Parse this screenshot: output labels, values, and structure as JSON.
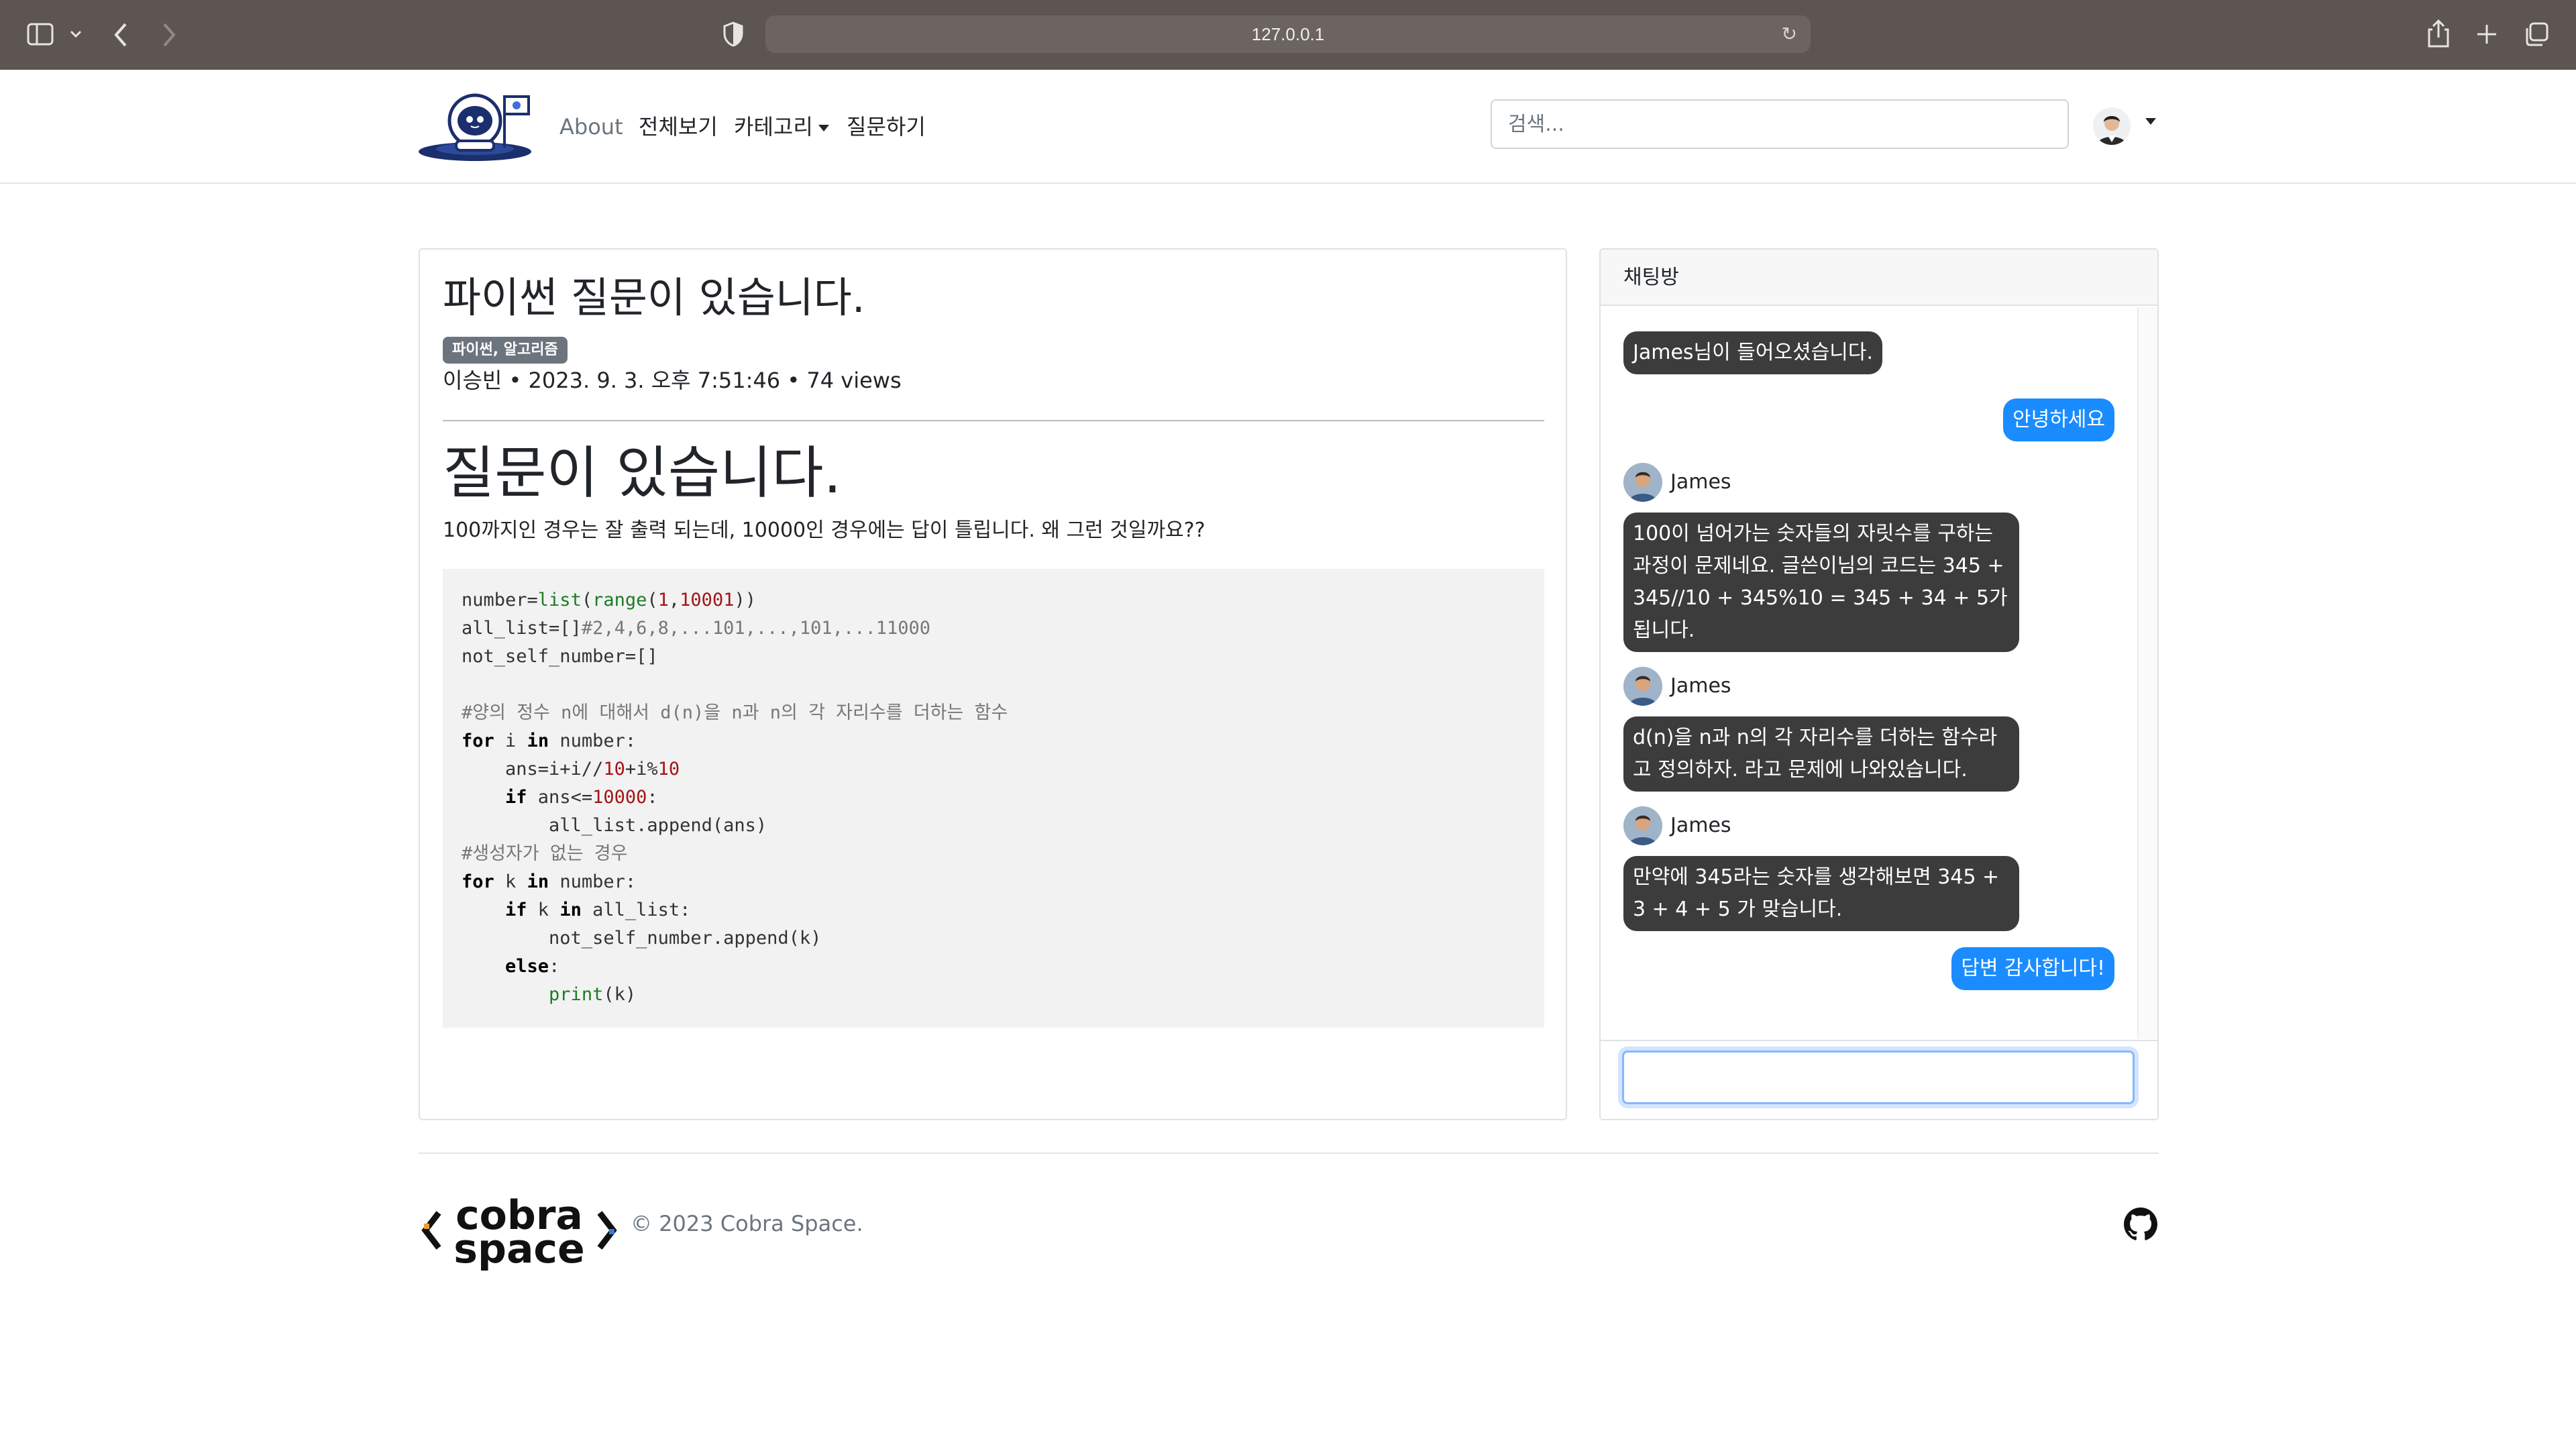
{
  "browser": {
    "url": "127.0.0.1"
  },
  "navbar": {
    "links": [
      "About",
      "전체보기",
      "카테고리",
      "질문하기"
    ],
    "search_placeholder": "검색..."
  },
  "post": {
    "title": "파이썬 질문이 있습니다.",
    "tag": "파이썬, 알고리즘",
    "author": "이승빈",
    "date": "2023. 9. 3. 오후 7:51:46",
    "views": "74 views",
    "content_heading": "질문이 있습니다.",
    "content_text": "100까지인 경우는 잘 출력 되는데, 10000인 경우에는 답이 틀립니다. 왜 그런 것일까요??",
    "code_lines": [
      "number=list(range(1,10001))",
      "all_list=[]#2,4,6,8,...101,...,101,...11000",
      "not_self_number=[]",
      "",
      "#양의 정수 n에 대해서 d(n)을 n과 n의 각 자리수를 더하는 함수",
      "for i in number:",
      "    ans=i+i//10+i%10",
      "    if ans<=10000:",
      "        all_list.append(ans)",
      "#생성자가 없는 경우",
      "for k in number:",
      "    if k in all_list:",
      "        not_self_number.append(k)",
      "    else:",
      "        print(k)"
    ]
  },
  "chat": {
    "title": "채팅방",
    "messages": [
      {
        "type": "system",
        "text": "James님이 들어오셨습니다."
      },
      {
        "type": "me",
        "text": "안녕하세요"
      },
      {
        "type": "other",
        "sender": "James",
        "text": "100이 넘어가는 숫자들의 자릿수를 구하는 과정이 문제네요.  글쓴이님의 코드는 345 + 345//10 + 345%10 = 345 + 34 + 5가 됩니다."
      },
      {
        "type": "other",
        "sender": "James",
        "text": "d(n)을 n과 n의 각 자리수를 더하는 함수라고 정의하자.  라고 문제에 나와있습니다."
      },
      {
        "type": "other",
        "sender": "James",
        "text": "만약에 345라는 숫자를 생각해보면 345 + 3 + 4 + 5 가 맞습니다."
      },
      {
        "type": "me",
        "text": "답변 감사합니다!"
      }
    ],
    "input_value": ""
  },
  "footer": {
    "logo_text": [
      "cobra",
      "space"
    ],
    "copyright": "© 2023 Cobra Space."
  },
  "colors": {
    "chrome": "#5c5552",
    "my_bubble": "#1a8cff",
    "other_bubble": "#3c3c3c",
    "badge": "#6c757d",
    "code_bg": "#f2f2f2"
  },
  "icons": [
    "sidebar-icon",
    "back-icon",
    "forward-icon",
    "shield-icon",
    "reload-icon",
    "share-icon",
    "new-tab-icon",
    "tabs-icon",
    "github-icon"
  ]
}
